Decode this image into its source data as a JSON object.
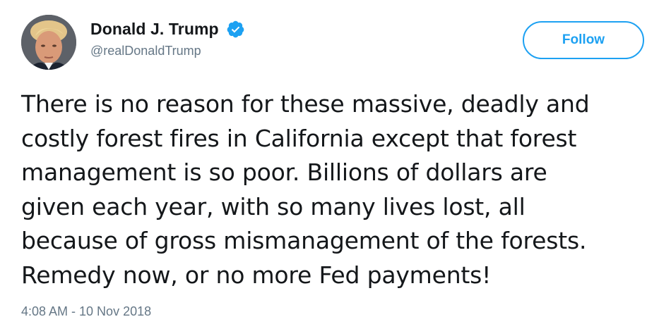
{
  "author": {
    "display_name": "Donald J. Trump",
    "handle": "@realDonaldTrump",
    "verified": true,
    "avatar_icon": "profile-photo"
  },
  "actions": {
    "follow_label": "Follow"
  },
  "tweet": {
    "lines": [
      "There is no reason for these massive, deadly and",
      "costly forest fires in California except that forest",
      "management is so poor. Billions of dollars are",
      "given each year, with so many lives lost, all",
      "because of gross mismanagement of the forests.",
      "Remedy now, or no more Fed payments!"
    ],
    "timestamp": "4:08 AM - 10 Nov 2018"
  },
  "colors": {
    "accent": "#1da1f2",
    "text": "#14171a",
    "secondary_text": "#657786"
  }
}
